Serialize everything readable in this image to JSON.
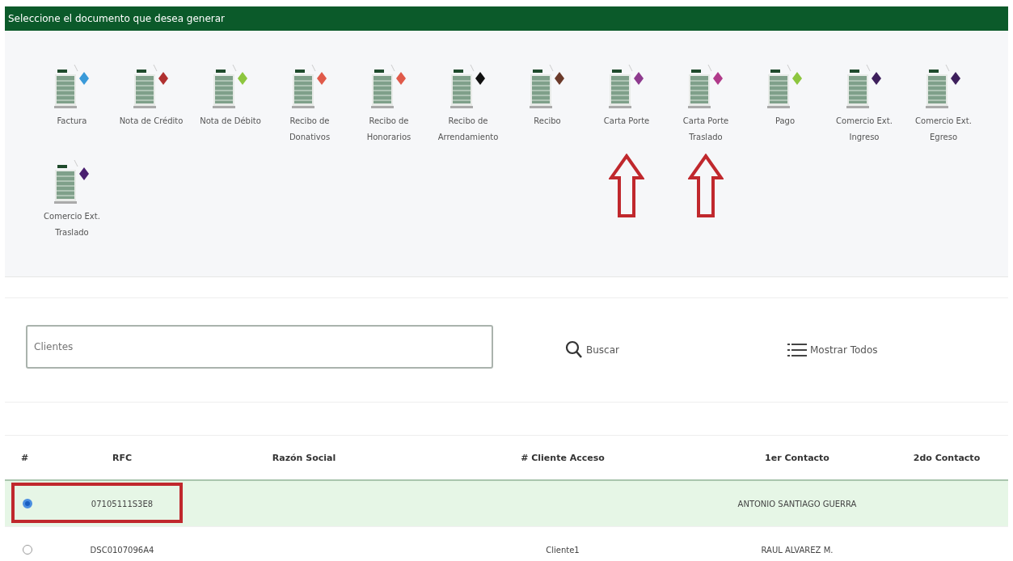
{
  "header": {
    "title": "Seleccione el documento que desea generar"
  },
  "documents": [
    {
      "label": "Factura",
      "color": "#3a9ad9",
      "pointed": false
    },
    {
      "label": "Nota de Crédito",
      "color": "#b03030",
      "pointed": false
    },
    {
      "label": "Nota de Débito",
      "color": "#8dc63f",
      "pointed": false
    },
    {
      "label": "Recibo de Donativos",
      "color": "#e05a4a",
      "pointed": false
    },
    {
      "label": "Recibo de Honorarios",
      "color": "#e05a4a",
      "pointed": false
    },
    {
      "label": "Recibo de Arrendamiento",
      "color": "#111111",
      "pointed": false
    },
    {
      "label": "Recibo",
      "color": "#6b3a2a",
      "pointed": false
    },
    {
      "label": "Carta Porte",
      "color": "#8e3a8e",
      "pointed": true
    },
    {
      "label": "Carta Porte Traslado",
      "color": "#b03a8a",
      "pointed": true
    },
    {
      "label": "Pago",
      "color": "#8dc63f",
      "pointed": false
    },
    {
      "label": "Comercio Ext. Ingreso",
      "color": "#3d1f5c",
      "pointed": false
    },
    {
      "label": "Comercio Ext. Egreso",
      "color": "#3d1f5c",
      "pointed": false
    },
    {
      "label": "Comercio Ext. Traslado",
      "color": "#4a2070",
      "pointed": false
    }
  ],
  "search": {
    "placeholder": "Clientes",
    "search_button": "Buscar",
    "show_all_button": "Mostrar Todos"
  },
  "table": {
    "columns": [
      "#",
      "RFC",
      "Razón Social",
      "# Cliente Acceso",
      "1er Contacto",
      "2do Contacto"
    ],
    "rows": [
      {
        "selected": true,
        "outlined": true,
        "cells": [
          "",
          "07105111S3E8",
          "",
          "",
          "ANTONIO SANTIAGO GUERRA",
          ""
        ]
      },
      {
        "selected": false,
        "outlined": false,
        "cells": [
          "",
          "DSC0107096A4",
          "",
          "Cliente1",
          "RAUL ALVAREZ M.",
          ""
        ]
      }
    ]
  }
}
